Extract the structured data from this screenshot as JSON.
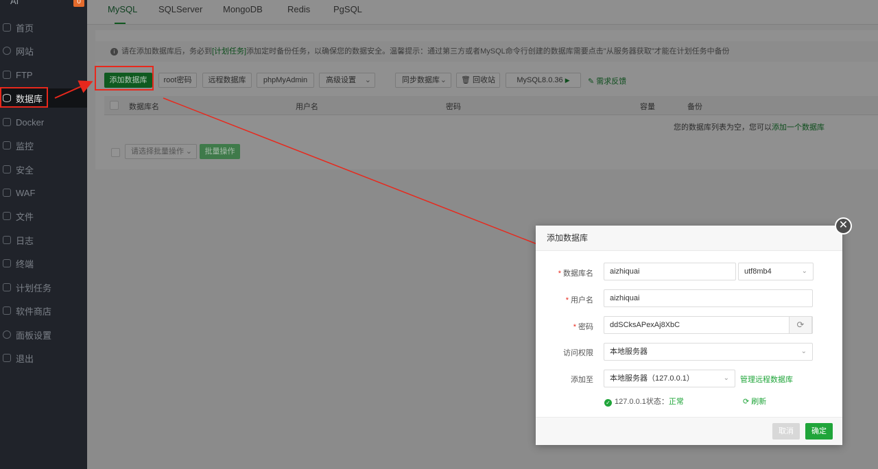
{
  "sidebar": {
    "top_label": "AI",
    "badge": "0",
    "items": [
      {
        "label": "首页"
      },
      {
        "label": "网站"
      },
      {
        "label": "FTP"
      },
      {
        "label": "数据库"
      },
      {
        "label": "Docker"
      },
      {
        "label": "监控"
      },
      {
        "label": "安全"
      },
      {
        "label": "WAF"
      },
      {
        "label": "文件"
      },
      {
        "label": "日志"
      },
      {
        "label": "终端"
      },
      {
        "label": "计划任务"
      },
      {
        "label": "软件商店"
      },
      {
        "label": "面板设置"
      },
      {
        "label": "退出"
      }
    ],
    "active_index": 3
  },
  "tabs": [
    "MySQL",
    "SQLServer",
    "MongoDB",
    "Redis",
    "PgSQL"
  ],
  "notice": {
    "pre": "请在添加数据库后，务必到",
    "link": "[计划任务]",
    "post": "添加定时备份任务，以确保您的数据安全。温馨提示：通过第三方或者MySQL命令行创建的数据库需要点击\"从服务器获取\"才能在计划任务中备份"
  },
  "toolbar": {
    "add_db": "添加数据库",
    "root_pwd": "root密码",
    "remote_db": "远程数据库",
    "phpmyadmin": "phpMyAdmin",
    "advanced": "高级设置",
    "sync_db": "同步数据库",
    "recycle": "回收站",
    "mysql_version": "MySQL8.0.36",
    "feedback": "需求反馈"
  },
  "table": {
    "columns": [
      "数据库名",
      "用户名",
      "密码",
      "容量",
      "备份"
    ],
    "empty_text": "您的数据库列表为空，您可以",
    "empty_link": "添加一个数据库"
  },
  "batch": {
    "select_placeholder": "请选择批量操作",
    "button": "批量操作"
  },
  "dialog": {
    "title": "添加数据库",
    "db_name_label": "数据库名",
    "db_name_value": "aizhiquai",
    "charset_value": "utf8mb4",
    "username_label": "用户名",
    "username_value": "aizhiquai",
    "password_label": "密码",
    "password_value": "ddSCksAPexAj8XbC",
    "access_label": "访问权限",
    "access_value": "本地服务器",
    "add_to_label": "添加至",
    "add_to_value": "本地服务器（127.0.0.1）",
    "manage_remote": "管理远程数据库",
    "status_prefix": "127.0.0.1状态：",
    "status_value": "正常",
    "refresh": "刷新",
    "cancel": "取消",
    "confirm": "确定"
  },
  "colors": {
    "accent_green": "#20a53a",
    "annotation_red": "#e8281c"
  }
}
